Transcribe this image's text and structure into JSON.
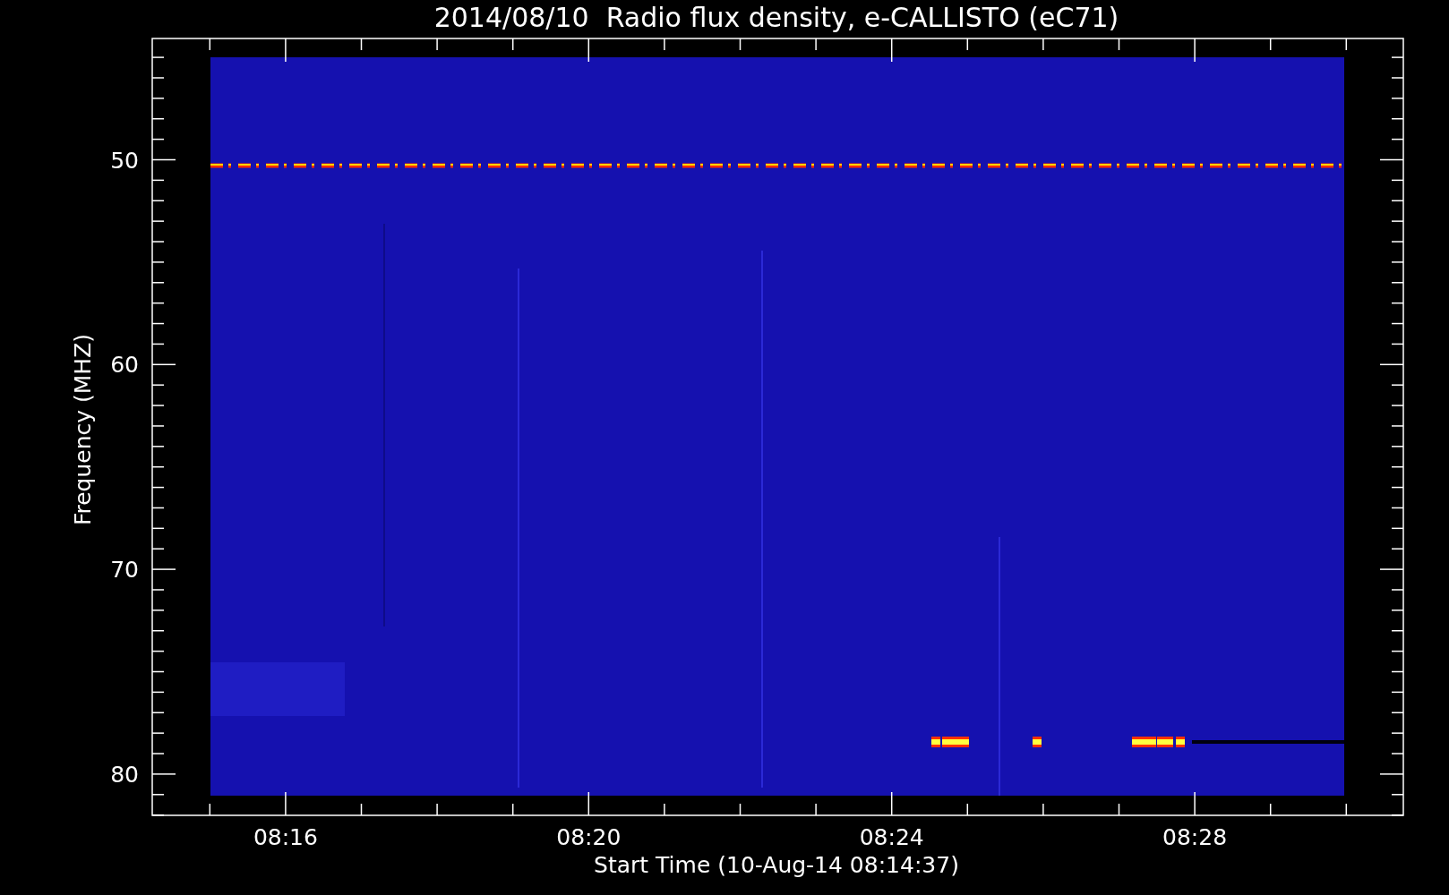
{
  "plot": {
    "title": "2014/08/10  Radio flux density, e-CALLISTO (eC71)",
    "ylabel": "Frequency (MHZ)",
    "xlabel": "Start Time (10-Aug-14 08:14:37)",
    "ytick_labels": [
      "50",
      "60",
      "70",
      "80"
    ],
    "xtick_labels": [
      "08:16",
      "08:20",
      "08:24",
      "08:28"
    ]
  }
}
